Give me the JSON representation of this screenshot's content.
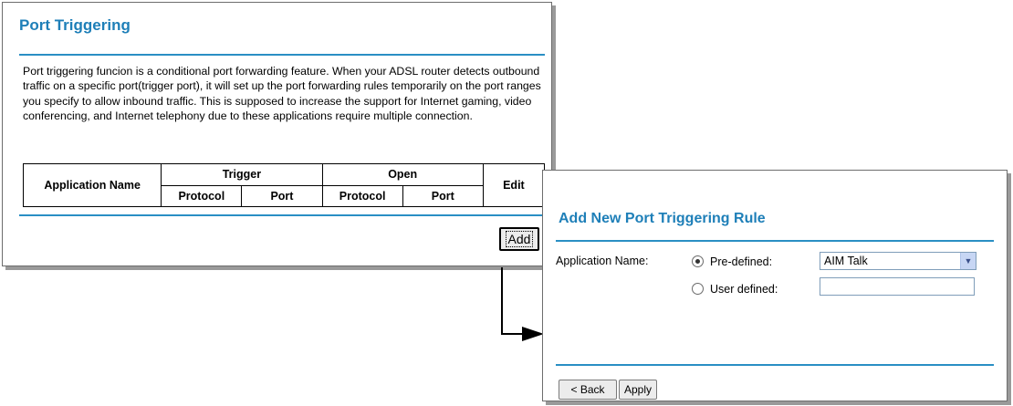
{
  "port_triggering": {
    "title": "Port Triggering",
    "description": "Port triggering funcion is a conditional port forwarding feature. When your ADSL router detects outbound traffic on a specific port(trigger port), it will set up the port forwarding rules temporarily on the port ranges you specify to allow inbound traffic. This is supposed to increase the support for Internet gaming, video conferencing, and Internet telephony due to these applications require multiple connection.",
    "table": {
      "application_name": "Application Name",
      "trigger": "Trigger",
      "open": "Open",
      "edit": "Edit",
      "protocol": "Protocol",
      "port": "Port"
    },
    "add_label": "Add"
  },
  "add_rule": {
    "title": "Add New Port Triggering Rule",
    "application_name_label": "Application Name:",
    "predefined_label": "Pre-defined:",
    "user_defined_label": "User defined:",
    "selected_application": "AIM Talk",
    "user_defined_value": "",
    "back_label": "< Back",
    "apply_label": "Apply"
  },
  "colors": {
    "title": "#1e7fb8",
    "rule": "#2a8fc4"
  }
}
